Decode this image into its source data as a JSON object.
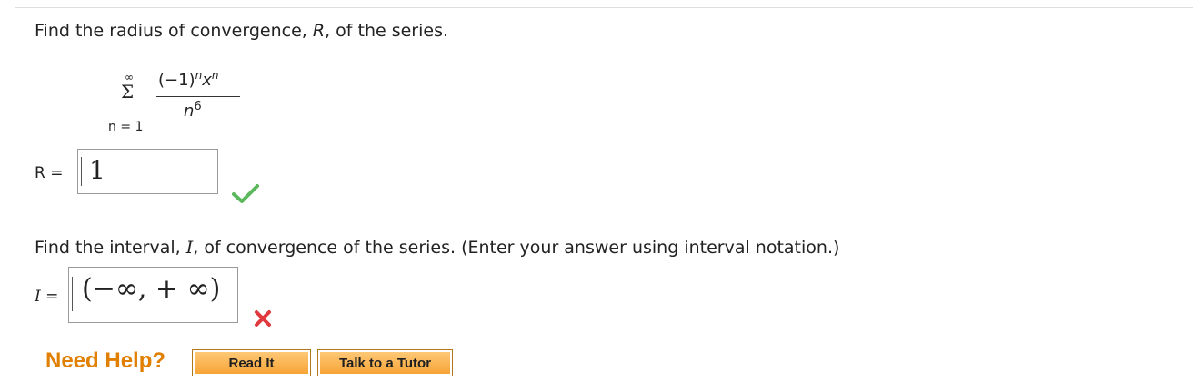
{
  "question1": {
    "prefix": "Find the radius of convergence, ",
    "var": "R",
    "suffix": ", of the series."
  },
  "series": {
    "upper_limit": "∞",
    "sigma": "Σ",
    "lower_limit": "n = 1",
    "numerator_base": "(−1)",
    "numerator_exp1": "n",
    "numerator_var": "x",
    "numerator_exp2": "n",
    "denominator_base": "n",
    "denominator_exp": "6"
  },
  "radius": {
    "label": "R =",
    "value": "1",
    "status": "correct"
  },
  "question2": {
    "prefix": "Find the interval, ",
    "var": "I",
    "suffix": ", of convergence of the series. (Enter your answer using interval notation.)"
  },
  "interval": {
    "label_var": "I",
    "label_eq": " =",
    "value": "(−∞, + ∞)",
    "status": "incorrect"
  },
  "help": {
    "label": "Need Help?",
    "read_it": "Read It",
    "talk_to_tutor": "Talk to a Tutor"
  },
  "colors": {
    "correct": "#5cb85c",
    "incorrect": "#e0393e",
    "help_text": "#e07f00",
    "button": "#f7a436"
  }
}
